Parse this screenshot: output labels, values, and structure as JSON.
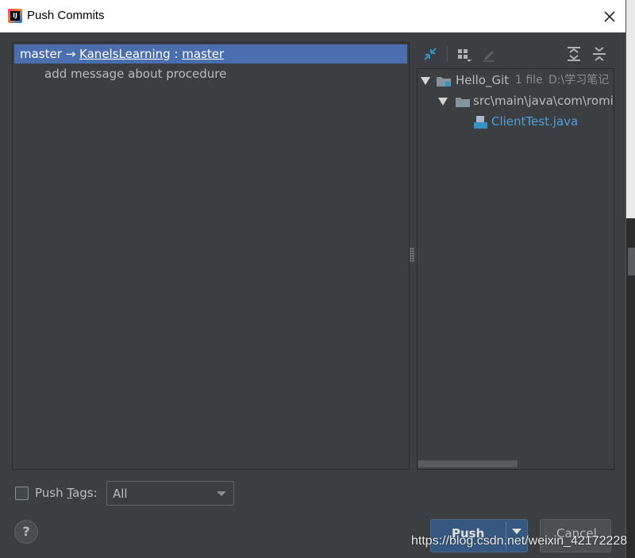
{
  "window": {
    "title": "Push Commits",
    "close_label": "✕"
  },
  "branch": {
    "local": "master",
    "arrow": "→",
    "remote": "KanelsLearning",
    "separator": ":",
    "remote_branch": "master"
  },
  "commits": [
    {
      "message": "add message about procedure"
    }
  ],
  "tree": {
    "root": {
      "name": "Hello_Git",
      "count": "1 file",
      "path": "D:\\学习笔记"
    },
    "folder": {
      "name": "src\\main\\java\\com\\romio"
    },
    "file": {
      "name": "ClientTest.java"
    }
  },
  "toolbar": {
    "icons": [
      "collapse-changes-icon",
      "group-by-icon",
      "edit-icon",
      "expand-all-icon",
      "collapse-all-icon"
    ]
  },
  "push_tags": {
    "label_pre": "Push ",
    "label_mnemonic": "T",
    "label_post": "ags:",
    "selected": "All"
  },
  "buttons": {
    "help": "?",
    "push": "Push",
    "cancel": "Cancel"
  },
  "watermark": "https://blog.csdn.net/weixin_42172228",
  "colors": {
    "selection": "#4b6eaf",
    "push_button": "#365880",
    "file_link": "#4f9fd9"
  }
}
